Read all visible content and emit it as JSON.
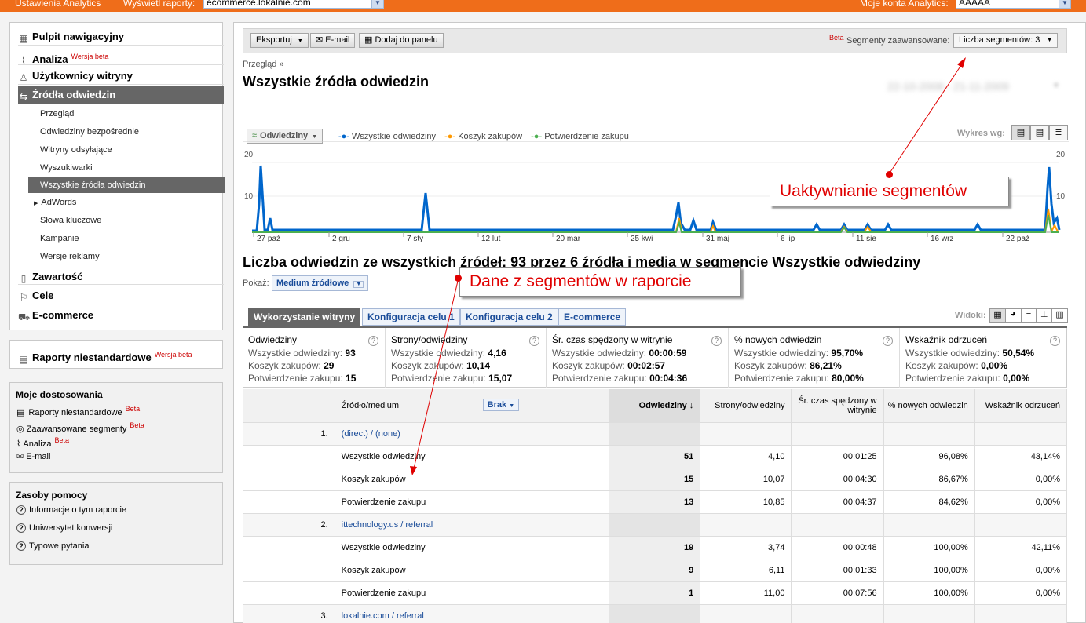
{
  "topbar": {
    "settings": "Ustawienia Analytics",
    "reports_label": "Wyświetl raporty:",
    "reports_value": "ecommerce.lokalnie.com",
    "accounts_label": "Moje konta Analytics:",
    "accounts_value": "AAAAA"
  },
  "nav": {
    "dashboard": "Pulpit nawigacyjny",
    "analysis": "Analiza",
    "analysis_beta": "Wersja beta",
    "visitors": "Użytkownicy witryny",
    "traffic": "Źródła odwiedzin",
    "sub": [
      "Przegląd",
      "Odwiedziny bezpośrednie",
      "Witryny odsyłające",
      "Wyszukiwarki",
      "Wszystkie źródła odwiedzin",
      "AdWords",
      "Słowa kluczowe",
      "Kampanie",
      "Wersje reklamy"
    ],
    "content": "Zawartość",
    "goals": "Cele",
    "ecommerce": "E-commerce"
  },
  "custom": {
    "label": "Raporty niestandardowe",
    "beta": "Wersja beta"
  },
  "my": {
    "title": "Moje dostosowania",
    "items": [
      "Raporty niestandardowe",
      "Zaawansowane segmenty",
      "Analiza",
      "E-mail"
    ],
    "beta": "Beta"
  },
  "help": {
    "title": "Zasoby pomocy",
    "items": [
      "Informacje o tym raporcie",
      "Uniwersytet konwersji",
      "Typowe pytania"
    ]
  },
  "toolbar": {
    "export": "Eksportuj",
    "email": "E-mail",
    "add": "Dodaj do panelu",
    "beta": "Beta",
    "segments_label": "Segmenty zaawansowane:",
    "segments_value": "Liczba segmentów: 3"
  },
  "page": {
    "breadcrumb": "Przegląd »",
    "title": "Wszystkie źródła odwiedzin",
    "date_range": "22-10-2008 - 21-11-2009"
  },
  "chart": {
    "metric": "Odwiedziny",
    "legend": [
      "Wszystkie odwiedziny",
      "Koszyk zakupów",
      "Potwierdzenie zakupu"
    ],
    "view_by": "Wykres wg:",
    "y_top": "20",
    "y_mid": "10",
    "x_labels": [
      "27 paź",
      "2 gru",
      "7 sty",
      "12 lut",
      "20 mar",
      "25 kwi",
      "31 maj",
      "6 lip",
      "11 sie",
      "16 wrz",
      "22 paź"
    ]
  },
  "chart_data": {
    "type": "line",
    "ylim": [
      0,
      20
    ],
    "categories": [
      "27 paź",
      "2 gru",
      "7 sty",
      "12 lut",
      "20 mar",
      "25 kwi",
      "31 maj",
      "6 lip",
      "11 sie",
      "16 wrz",
      "22 paź"
    ],
    "series": [
      {
        "name": "Wszystkie odwiedziny",
        "color": "#0066cc"
      },
      {
        "name": "Koszyk zakupów",
        "color": "#ff9900"
      },
      {
        "name": "Potwierdzenie zakupu",
        "color": "#4caf50"
      }
    ]
  },
  "report": {
    "heading": "Liczba odwiedzin ze wszystkich źródeł: 93 przez 6 źródła i media w segmencie Wszystkie odwiedziny",
    "show_label": "Pokaż:",
    "show_value": "Medium źródłowe",
    "tabs": [
      "Wykorzystanie witryny",
      "Konfiguracja celu 1",
      "Konfiguracja celu 2",
      "E-commerce"
    ],
    "views": "Widoki:"
  },
  "metrics": [
    {
      "title": "Odwiedziny",
      "rows": [
        [
          "Wszystkie odwiedziny:",
          "93"
        ],
        [
          "Koszyk zakupów:",
          "29"
        ],
        [
          "Potwierdzenie zakupu:",
          "15"
        ]
      ]
    },
    {
      "title": "Strony/odwiedziny",
      "rows": [
        [
          "Wszystkie odwiedziny:",
          "4,16"
        ],
        [
          "Koszyk zakupów:",
          "10,14"
        ],
        [
          "Potwierdzenie zakupu:",
          "15,07"
        ]
      ]
    },
    {
      "title": "Śr. czas spędzony w witrynie",
      "rows": [
        [
          "Wszystkie odwiedziny:",
          "00:00:59"
        ],
        [
          "Koszyk zakupów:",
          "00:02:57"
        ],
        [
          "Potwierdzenie zakupu:",
          "00:04:36"
        ]
      ]
    },
    {
      "title": "% nowych odwiedzin",
      "rows": [
        [
          "Wszystkie odwiedziny:",
          "95,70%"
        ],
        [
          "Koszyk zakupów:",
          "86,21%"
        ],
        [
          "Potwierdzenie zakupu:",
          "80,00%"
        ]
      ]
    },
    {
      "title": "Wskaźnik odrzuceń",
      "rows": [
        [
          "Wszystkie odwiedziny:",
          "50,54%"
        ],
        [
          "Koszyk zakupów:",
          "0,00%"
        ],
        [
          "Potwierdzenie zakupu:",
          "0,00%"
        ]
      ]
    }
  ],
  "table": {
    "headers": [
      "Źródło/medium",
      "Odwiedziny",
      "Strony/odwiedziny",
      "Śr. czas spędzony w witrynie",
      "% nowych odwiedzin",
      "Wskaźnik odrzuceń"
    ],
    "none_label": "Brak",
    "groups": [
      {
        "idx": "1.",
        "name": "(direct) / (none)",
        "rows": [
          [
            "Wszystkie odwiedziny",
            "51",
            "4,10",
            "00:01:25",
            "96,08%",
            "43,14%"
          ],
          [
            "Koszyk zakupów",
            "15",
            "10,07",
            "00:04:30",
            "86,67%",
            "0,00%"
          ],
          [
            "Potwierdzenie zakupu",
            "13",
            "10,85",
            "00:04:37",
            "84,62%",
            "0,00%"
          ]
        ]
      },
      {
        "idx": "2.",
        "name": "ittechnology.us / referral",
        "rows": [
          [
            "Wszystkie odwiedziny",
            "19",
            "3,74",
            "00:00:48",
            "100,00%",
            "42,11%"
          ],
          [
            "Koszyk zakupów",
            "9",
            "6,11",
            "00:01:33",
            "100,00%",
            "0,00%"
          ],
          [
            "Potwierdzenie zakupu",
            "1",
            "11,00",
            "00:07:56",
            "100,00%",
            "0,00%"
          ]
        ]
      },
      {
        "idx": "3.",
        "name": "lokalnie.com / referral",
        "rows": []
      }
    ]
  },
  "annotations": {
    "segments": "Uaktywnianie segmentów",
    "data": "Dane z segmentów w raporcie"
  }
}
